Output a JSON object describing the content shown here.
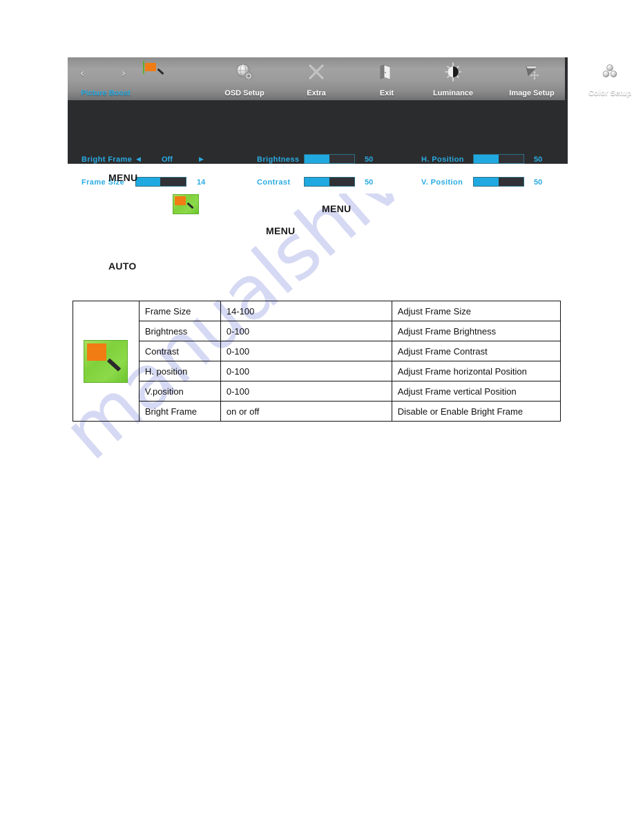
{
  "osd": {
    "menu_items": [
      {
        "label": "Picture Boost",
        "icon": "picture-boost-thumbnail-icon",
        "active": true
      },
      {
        "label": "OSD Setup",
        "icon": "globe-gear-icon",
        "active": false
      },
      {
        "label": "Extra",
        "icon": "crossed-tools-icon",
        "active": false
      },
      {
        "label": "Exit",
        "icon": "exit-door-icon",
        "active": false
      },
      {
        "label": "Luminance",
        "icon": "sun-brightness-icon",
        "active": false
      },
      {
        "label": "Image Setup",
        "icon": "image-move-arrow-icon",
        "active": false
      },
      {
        "label": "Color Setup",
        "icon": "three-spheres-icon",
        "active": false
      }
    ],
    "nav_arrow_left": "‹",
    "nav_arrow_right": "›",
    "settings": {
      "bright_frame": {
        "label": "Bright Frame",
        "value": "Off",
        "arrow_left": "◀",
        "arrow_right": "▶"
      },
      "frame_size": {
        "label": "Frame Size",
        "value": "14",
        "fill_percent": 48
      },
      "brightness": {
        "label": "Brightness",
        "value": "50",
        "fill_percent": 50
      },
      "contrast": {
        "label": "Contrast",
        "value": "50",
        "fill_percent": 50
      },
      "h_position": {
        "label": "H. Position",
        "value": "50",
        "fill_percent": 50
      },
      "v_position": {
        "label": "V. Position",
        "value": "50",
        "fill_percent": 50
      }
    },
    "colors": {
      "accent": "#29abe2",
      "slider_fill": "#1fa9e0",
      "panel_bg": "#2b2c2e"
    }
  },
  "body_text": {
    "menu_1": "MENU",
    "menu_2": "MENU",
    "menu_3": "MENU",
    "auto_1": "AUTO"
  },
  "table": {
    "rows": [
      {
        "name": "Frame Size",
        "range": "14-100",
        "desc": "Adjust Frame Size"
      },
      {
        "name": "Brightness",
        "range": "0-100",
        "desc": "Adjust Frame Brightness"
      },
      {
        "name": "Contrast",
        "range": "0-100",
        "desc": "Adjust Frame Contrast"
      },
      {
        "name": "H. position",
        "range": "0-100",
        "desc": "Adjust Frame horizontal Position"
      },
      {
        "name": "V.position",
        "range": "0-100",
        "desc": "Adjust Frame vertical Position"
      },
      {
        "name": "Bright Frame",
        "range": "on or off",
        "desc": "Disable or Enable Bright Frame"
      }
    ],
    "icon": "picture-boost-thumbnail-icon"
  },
  "watermark": {
    "text": "manualshive.com",
    "color": "#c9cdf0"
  }
}
